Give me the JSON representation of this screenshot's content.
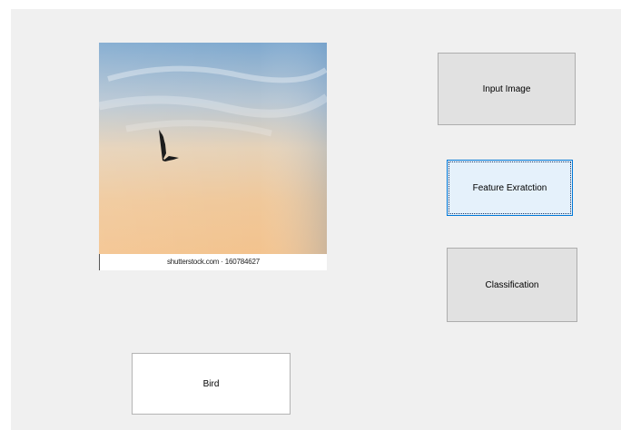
{
  "picture": {
    "watermark": "shutterstock.com · 160784627",
    "subject": "bird"
  },
  "buttons": {
    "input_image": "Input Image",
    "feature_extraction": "Feature Exratction",
    "classification": "Classification"
  },
  "result": {
    "label": "Bird"
  },
  "colors": {
    "form_background": "#f0f0f0",
    "button_face": "#e1e1e1",
    "focused_button_face": "#e5f1fb",
    "focus_border": "#0078d7"
  }
}
